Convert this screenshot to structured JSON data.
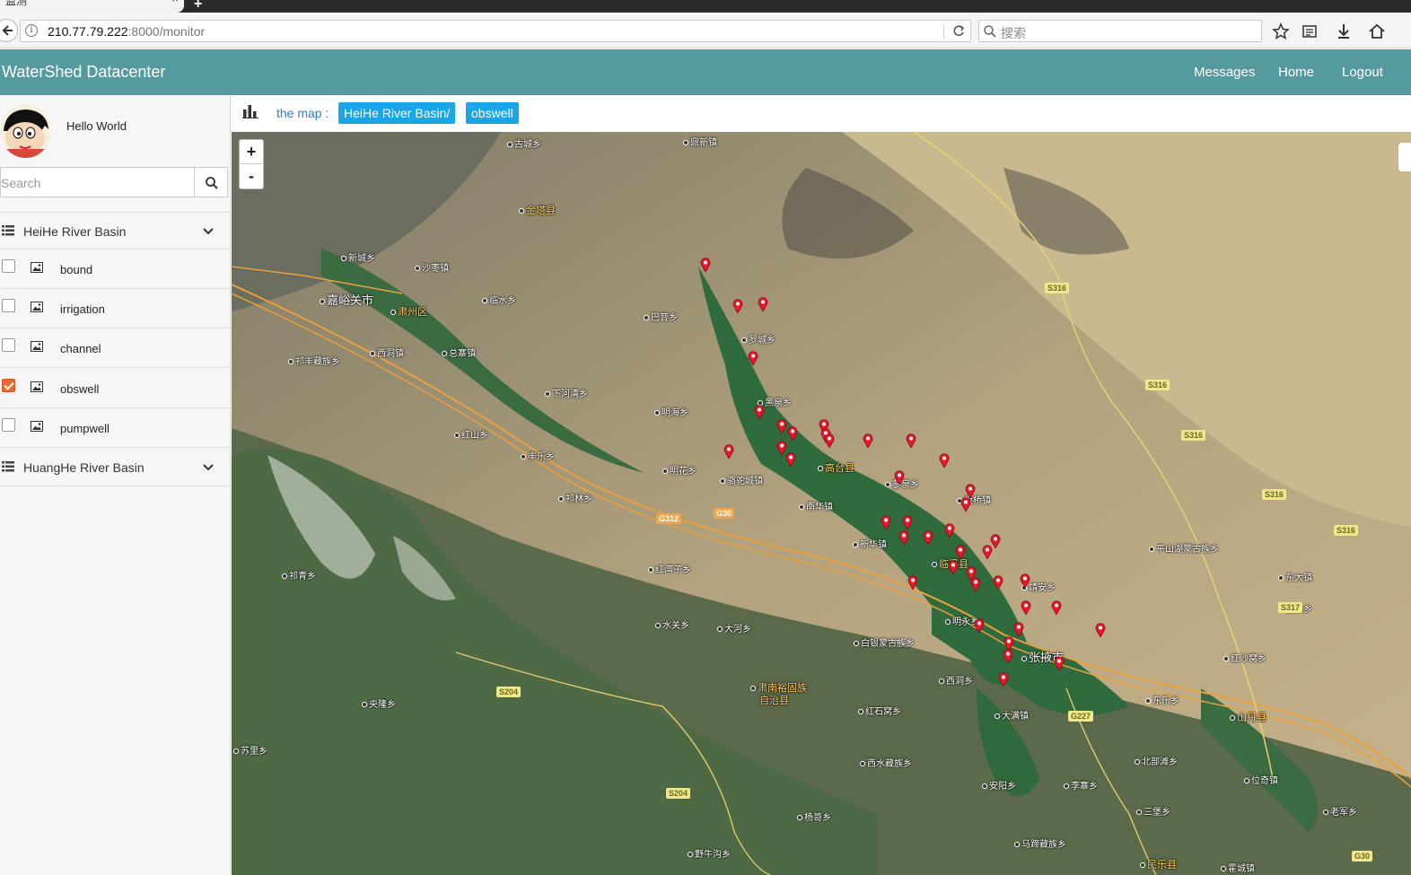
{
  "browser": {
    "tab_title": "监测",
    "tab_close": "×",
    "new_tab": "+",
    "url_host": "210.77.79.222",
    "url_path": ":8000/monitor",
    "search_placeholder": "搜索"
  },
  "appbar": {
    "brand": "WaterShed Datacenter",
    "links": [
      "Messages",
      "Home",
      "Logout"
    ]
  },
  "sidebar": {
    "greeting": "Hello World",
    "search_placeholder": "Search",
    "groups": [
      {
        "label": "HeiHe River Basin",
        "expanded": true,
        "layers": [
          {
            "label": "bound",
            "checked": false
          },
          {
            "label": "irrigation",
            "checked": false
          },
          {
            "label": "channel",
            "checked": false
          },
          {
            "label": "obswell",
            "checked": true
          },
          {
            "label": "pumpwell",
            "checked": false
          }
        ]
      },
      {
        "label": "HuangHe River Basin",
        "expanded": false
      }
    ]
  },
  "mapbar": {
    "label": "the map :",
    "crumbs": [
      "HeiHe River Basin/",
      "obswell"
    ]
  },
  "map": {
    "zoom_in": "+",
    "zoom_out": "-",
    "places": [
      {
        "name": "嘉峪关市"
      },
      {
        "name": "肃州区"
      },
      {
        "name": "金塔县"
      },
      {
        "name": "高台县"
      },
      {
        "name": "张掖市"
      },
      {
        "name": "临泽县"
      },
      {
        "name": "山丹县"
      },
      {
        "name": "民乐县"
      },
      {
        "name": "肃南裕固族"
      },
      {
        "name": "自治县"
      },
      {
        "name": "新城乡"
      },
      {
        "name": "沙枣镇"
      },
      {
        "name": "西洞镇"
      },
      {
        "name": "总寨镇"
      },
      {
        "name": "临水乡"
      },
      {
        "name": "祁丰藏族乡"
      },
      {
        "name": "下河清乡"
      },
      {
        "name": "红山乡"
      },
      {
        "name": "丰乐乡"
      },
      {
        "name": "祁林乡"
      },
      {
        "name": "明海乡"
      },
      {
        "name": "明花乡"
      },
      {
        "name": "骆驼城镇"
      },
      {
        "name": "南华镇"
      },
      {
        "name": "黑泉乡"
      },
      {
        "name": "罗城乡"
      },
      {
        "name": "巴音乡"
      },
      {
        "name": "古城乡"
      },
      {
        "name": "鼎新镇"
      },
      {
        "name": "蓼泉乡"
      },
      {
        "name": "板桥镇"
      },
      {
        "name": "新华镇"
      },
      {
        "name": "靖安乡"
      },
      {
        "name": "明永乡"
      },
      {
        "name": "平山湖蒙古族乡"
      },
      {
        "name": "红沙窝乡"
      },
      {
        "name": "红湾子乡"
      },
      {
        "name": "水关乡"
      },
      {
        "name": "大河乡"
      },
      {
        "name": "白银蒙古族乡"
      },
      {
        "name": "西洞乡"
      },
      {
        "name": "大满镇"
      },
      {
        "name": "东乐乡"
      },
      {
        "name": "红石窝乡"
      },
      {
        "name": "西水藏族乡"
      },
      {
        "name": "安阳乡"
      },
      {
        "name": "李寨乡"
      },
      {
        "name": "北部滩乡"
      },
      {
        "name": "位奇镇"
      },
      {
        "name": "三堡乡"
      },
      {
        "name": "老军乡"
      },
      {
        "name": "杨哥乡"
      },
      {
        "name": "马蹄藏族乡"
      },
      {
        "name": "野牛沟乡"
      },
      {
        "name": "央隆乡"
      },
      {
        "name": "苏里乡"
      },
      {
        "name": "祁青乡"
      },
      {
        "name": "霍城镇"
      },
      {
        "name": "东大镇"
      },
      {
        "name": "西店乡"
      }
    ],
    "shields": [
      "S316",
      "S316",
      "S316",
      "S316",
      "S316",
      "S317",
      "G312",
      "G30",
      "G227",
      "S204",
      "S204",
      "G30"
    ]
  }
}
